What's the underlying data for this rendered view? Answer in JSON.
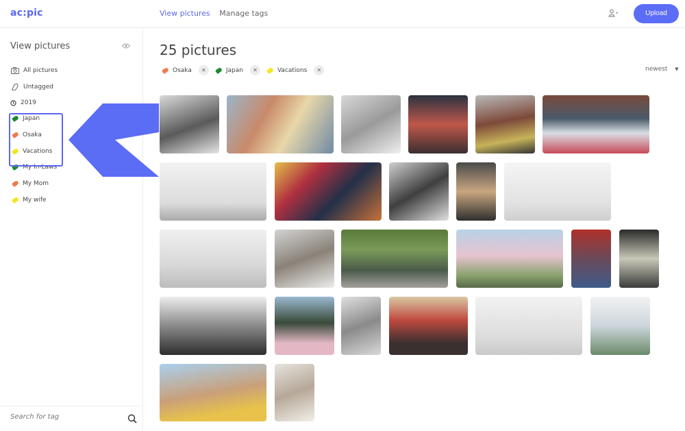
{
  "app": {
    "logo": "ac:pic"
  },
  "nav": {
    "view_pictures": "View pictures",
    "manage_tags": "Manage tags"
  },
  "header": {
    "upload_label": "Upload"
  },
  "sidebar": {
    "title": "View pictures",
    "items": [
      {
        "label": "All pictures",
        "icon": "camera-icon"
      },
      {
        "label": "Untagged",
        "icon": "tag-outline-icon"
      },
      {
        "label": "2019",
        "icon": "clock-icon"
      },
      {
        "label": "Japan",
        "color": "#1a8a2e"
      },
      {
        "label": "Osaka",
        "color": "#f07a4a"
      },
      {
        "label": "Vacations",
        "color": "#f2e61a"
      },
      {
        "label": "My In-Laws",
        "color": "#1a8a2e"
      },
      {
        "label": "My Mom",
        "color": "#f07a4a"
      },
      {
        "label": "My wife",
        "color": "#f2e61a"
      }
    ],
    "search_placeholder": "Search for tag"
  },
  "main": {
    "title": "25 pictures",
    "filters": [
      {
        "label": "Osaka",
        "color": "#f07a4a"
      },
      {
        "label": "Japan",
        "color": "#1a8a2e"
      },
      {
        "label": "Vacations",
        "color": "#f2e61a"
      }
    ],
    "sort": "newest"
  },
  "colors": {
    "accent": "#5b67f2"
  }
}
